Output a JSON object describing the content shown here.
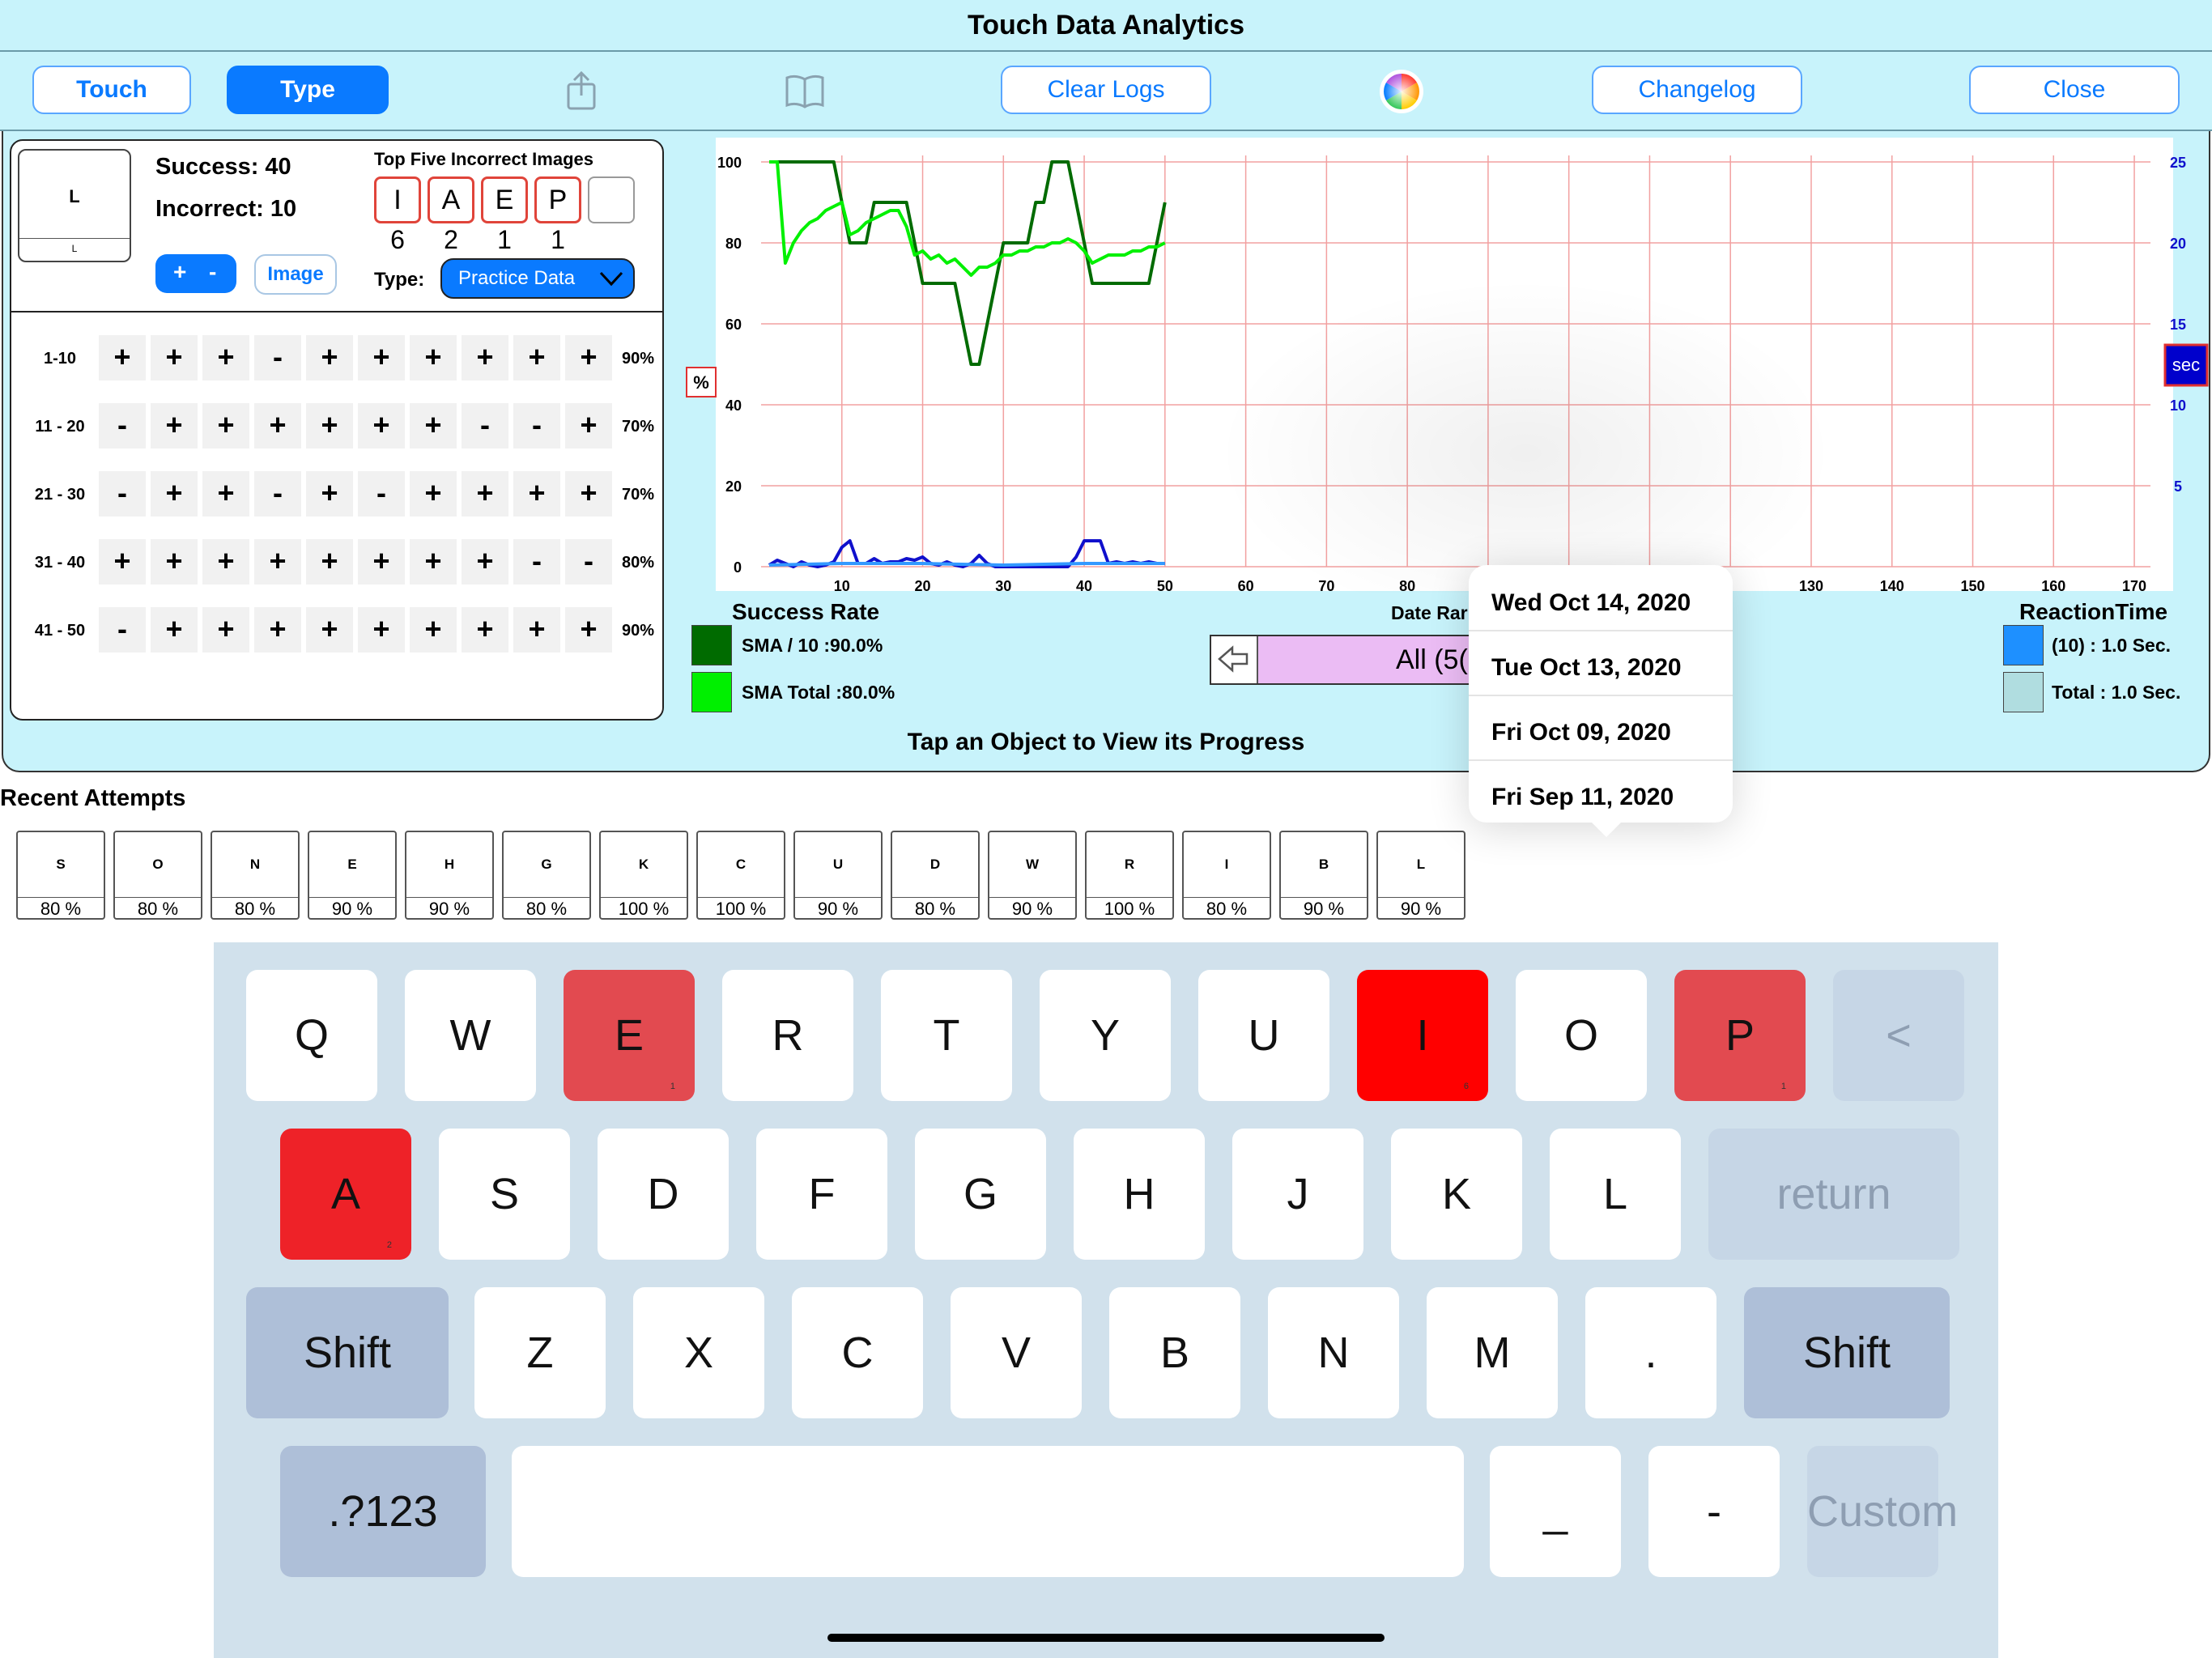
{
  "app": {
    "title": "Touch Data Analytics"
  },
  "toolbar": {
    "touch_label": "Touch",
    "type_label": "Type",
    "share_icon": "share-icon",
    "book_icon": "book-icon",
    "clear_logs_label": "Clear Logs",
    "color_icon": "color-wheel-icon",
    "changelog_label": "Changelog",
    "close_label": "Close"
  },
  "summary": {
    "preview_big": "L",
    "preview_small": "L",
    "success": "Success: 40",
    "incorrect": "Incorrect: 10",
    "plus": "+",
    "minus": "-",
    "image_label": "Image",
    "top5_title": "Top Five Incorrect Images",
    "top5": [
      {
        "letter": "I",
        "count": "6"
      },
      {
        "letter": "A",
        "count": "2"
      },
      {
        "letter": "E",
        "count": "1"
      },
      {
        "letter": "P",
        "count": "1"
      },
      {
        "letter": "",
        "count": ""
      }
    ],
    "type_label": "Type:",
    "type_value": "Practice Data"
  },
  "grid": {
    "rows": [
      {
        "label": "1-10",
        "cells": [
          "+",
          "+",
          "+",
          "-",
          "+",
          "+",
          "+",
          "+",
          "+",
          "+"
        ],
        "pct": "90%"
      },
      {
        "label": "11 - 20",
        "cells": [
          "-",
          "+",
          "+",
          "+",
          "+",
          "+",
          "+",
          "-",
          "-",
          "+"
        ],
        "pct": "70%"
      },
      {
        "label": "21 - 30",
        "cells": [
          "-",
          "+",
          "+",
          "-",
          "+",
          "-",
          "+",
          "+",
          "+",
          "+"
        ],
        "pct": "70%"
      },
      {
        "label": "31 - 40",
        "cells": [
          "+",
          "+",
          "+",
          "+",
          "+",
          "+",
          "+",
          "+",
          "-",
          "-"
        ],
        "pct": "80%"
      },
      {
        "label": "41 - 50",
        "cells": [
          "-",
          "+",
          "+",
          "+",
          "+",
          "+",
          "+",
          "+",
          "+",
          "+"
        ],
        "pct": "90%"
      }
    ]
  },
  "chart_data": {
    "type": "line",
    "x_ticks": [
      10,
      20,
      30,
      40,
      50,
      60,
      70,
      80,
      90,
      100,
      110,
      120,
      130,
      140,
      150,
      160,
      170
    ],
    "x_tick_labels": [
      "10",
      "20",
      "30",
      "40",
      "50",
      "60",
      "70",
      "80",
      "",
      "",
      "",
      "",
      "130",
      "140",
      "150",
      "160",
      "170"
    ],
    "xlim": [
      0,
      172
    ],
    "ylim": [
      0,
      100
    ],
    "y_ticks": [
      0,
      20,
      40,
      60,
      80,
      100
    ],
    "y2lim": [
      0,
      25
    ],
    "y2_ticks": [
      5,
      10,
      15,
      20,
      25
    ],
    "y_unit_badge": "%",
    "y2_unit_badge": "sec",
    "grid": true,
    "grid_color": "#f2a0a0",
    "series": [
      {
        "name": "SMA / 10",
        "color": "#006b00",
        "axis": "left",
        "x": [
          1,
          2,
          3,
          4,
          5,
          6,
          7,
          8,
          9,
          10,
          11,
          12,
          13,
          14,
          15,
          16,
          17,
          18,
          19,
          20,
          21,
          22,
          23,
          24,
          25,
          26,
          27,
          28,
          29,
          30,
          31,
          32,
          33,
          34,
          35,
          36,
          37,
          38,
          39,
          40,
          41,
          42,
          43,
          44,
          45,
          46,
          47,
          48,
          49,
          50
        ],
        "values": [
          100,
          100,
          100,
          100,
          100,
          100,
          100,
          100,
          100,
          90,
          80,
          80,
          80,
          90,
          90,
          90,
          90,
          90,
          80,
          70,
          70,
          70,
          70,
          70,
          60,
          50,
          50,
          60,
          70,
          80,
          80,
          80,
          80,
          90,
          90,
          100,
          100,
          100,
          90,
          80,
          70,
          70,
          70,
          70,
          70,
          70,
          70,
          70,
          80,
          90
        ]
      },
      {
        "name": "SMA Total",
        "color": "#00f000",
        "axis": "left",
        "x": [
          1,
          2,
          3,
          4,
          5,
          6,
          7,
          8,
          9,
          10,
          11,
          12,
          13,
          14,
          15,
          16,
          17,
          18,
          19,
          20,
          21,
          22,
          23,
          24,
          25,
          26,
          27,
          28,
          29,
          30,
          31,
          32,
          33,
          34,
          35,
          36,
          37,
          38,
          39,
          40,
          41,
          42,
          43,
          44,
          45,
          46,
          47,
          48,
          49,
          50
        ],
        "values": [
          100,
          100,
          75,
          80,
          83,
          85,
          86,
          88,
          89,
          90,
          82,
          83,
          85,
          86,
          87,
          88,
          88,
          84,
          77,
          78,
          76,
          77,
          75,
          76,
          74,
          72,
          74,
          74,
          75,
          77,
          77,
          78,
          78,
          79,
          79,
          80,
          80,
          81,
          80,
          78,
          75,
          76,
          77,
          77,
          77,
          78,
          78,
          79,
          79,
          80
        ]
      },
      {
        "name": "(10)",
        "color": "#1010cc",
        "axis": "right",
        "x": [
          1,
          2,
          3,
          4,
          5,
          6,
          7,
          8,
          9,
          10,
          11,
          12,
          13,
          14,
          15,
          16,
          17,
          18,
          19,
          20,
          21,
          22,
          23,
          24,
          25,
          26,
          27,
          28,
          29,
          30,
          31,
          32,
          33,
          34,
          35,
          36,
          37,
          38,
          39,
          40,
          41,
          42,
          43,
          44,
          45,
          46,
          47,
          48,
          49,
          50
        ],
        "values": [
          0.1,
          0.4,
          0.2,
          0.0,
          0.3,
          0.1,
          0.0,
          0.1,
          0.3,
          1.2,
          1.6,
          0.2,
          0.2,
          0.5,
          0.2,
          0.3,
          0.3,
          0.5,
          0.4,
          0.6,
          0.2,
          0.1,
          0.3,
          0.1,
          0.0,
          0.2,
          0.7,
          0.2,
          0.0,
          0.0,
          0.0,
          0.0,
          0.0,
          0.0,
          0.0,
          0.0,
          0.0,
          0.0,
          0.6,
          1.6,
          1.6,
          1.6,
          0.2,
          0.3,
          0.2,
          0.3,
          0.2,
          0.3,
          0.2,
          0.2
        ]
      },
      {
        "name": "Total",
        "color": "#3399ff",
        "axis": "right",
        "x": [
          1,
          10,
          20,
          30,
          40,
          50
        ],
        "values": [
          0.1,
          0.2,
          0.2,
          0.1,
          0.2,
          0.2
        ]
      }
    ]
  },
  "legend": {
    "success_title": "Success Rate",
    "sma10": "SMA / 10     :90.0%",
    "sma_total": "SMA Total :80.0%",
    "sma10_color": "#006b00",
    "sma_total_color": "#00f000",
    "reaction_title": "ReactionTime",
    "rt10": "(10) : 1.0 Sec.",
    "rt_total": "Total : 1.0 Sec.",
    "rt10_color": "#1e90ff",
    "rt_total_color": "#b0dde0",
    "date_range_title": "Date Rar",
    "date_range_value": "All (5("
  },
  "hint": "Tap an Object to View its Progress",
  "recent": {
    "title": "Recent Attempts",
    "tiles": [
      {
        "letter": "S",
        "pct": "80 %"
      },
      {
        "letter": "O",
        "pct": "80 %"
      },
      {
        "letter": "N",
        "pct": "80 %"
      },
      {
        "letter": "E",
        "pct": "90 %"
      },
      {
        "letter": "H",
        "pct": "90 %"
      },
      {
        "letter": "G",
        "pct": "80 %"
      },
      {
        "letter": "K",
        "pct": "100 %"
      },
      {
        "letter": "C",
        "pct": "100 %"
      },
      {
        "letter": "U",
        "pct": "90 %"
      },
      {
        "letter": "D",
        "pct": "80 %"
      },
      {
        "letter": "W",
        "pct": "90 %"
      },
      {
        "letter": "R",
        "pct": "100 %"
      },
      {
        "letter": "I",
        "pct": "80 %"
      },
      {
        "letter": "B",
        "pct": "90 %"
      },
      {
        "letter": "L",
        "pct": "90 %"
      }
    ]
  },
  "popover": {
    "dates": [
      "Wed  Oct 14, 2020",
      "Tue  Oct 13, 2020",
      "Fri  Oct 09, 2020",
      "Fri  Sep 11, 2020"
    ]
  },
  "keyboard": {
    "row1": [
      {
        "label": "Q"
      },
      {
        "label": "W"
      },
      {
        "label": "E",
        "count": "1"
      },
      {
        "label": "R"
      },
      {
        "label": "T"
      },
      {
        "label": "Y"
      },
      {
        "label": "U"
      },
      {
        "label": "I",
        "count": "6"
      },
      {
        "label": "O"
      },
      {
        "label": "P",
        "count": "1"
      },
      {
        "label": "<"
      }
    ],
    "row2": [
      {
        "label": "A",
        "count": "2"
      },
      {
        "label": "S"
      },
      {
        "label": "D"
      },
      {
        "label": "F"
      },
      {
        "label": "G"
      },
      {
        "label": "H"
      },
      {
        "label": "J"
      },
      {
        "label": "K"
      },
      {
        "label": "L"
      },
      {
        "label": "return"
      }
    ],
    "row3": [
      {
        "label": "Shift"
      },
      {
        "label": "Z"
      },
      {
        "label": "X"
      },
      {
        "label": "C"
      },
      {
        "label": "V"
      },
      {
        "label": "B"
      },
      {
        "label": "N"
      },
      {
        "label": "M"
      },
      {
        "label": "."
      },
      {
        "label": "Shift"
      }
    ],
    "row4": [
      {
        "label": ".?123"
      },
      {
        "label": ""
      },
      {
        "label": "_"
      },
      {
        "label": "-"
      },
      {
        "label": "Custom"
      }
    ]
  }
}
